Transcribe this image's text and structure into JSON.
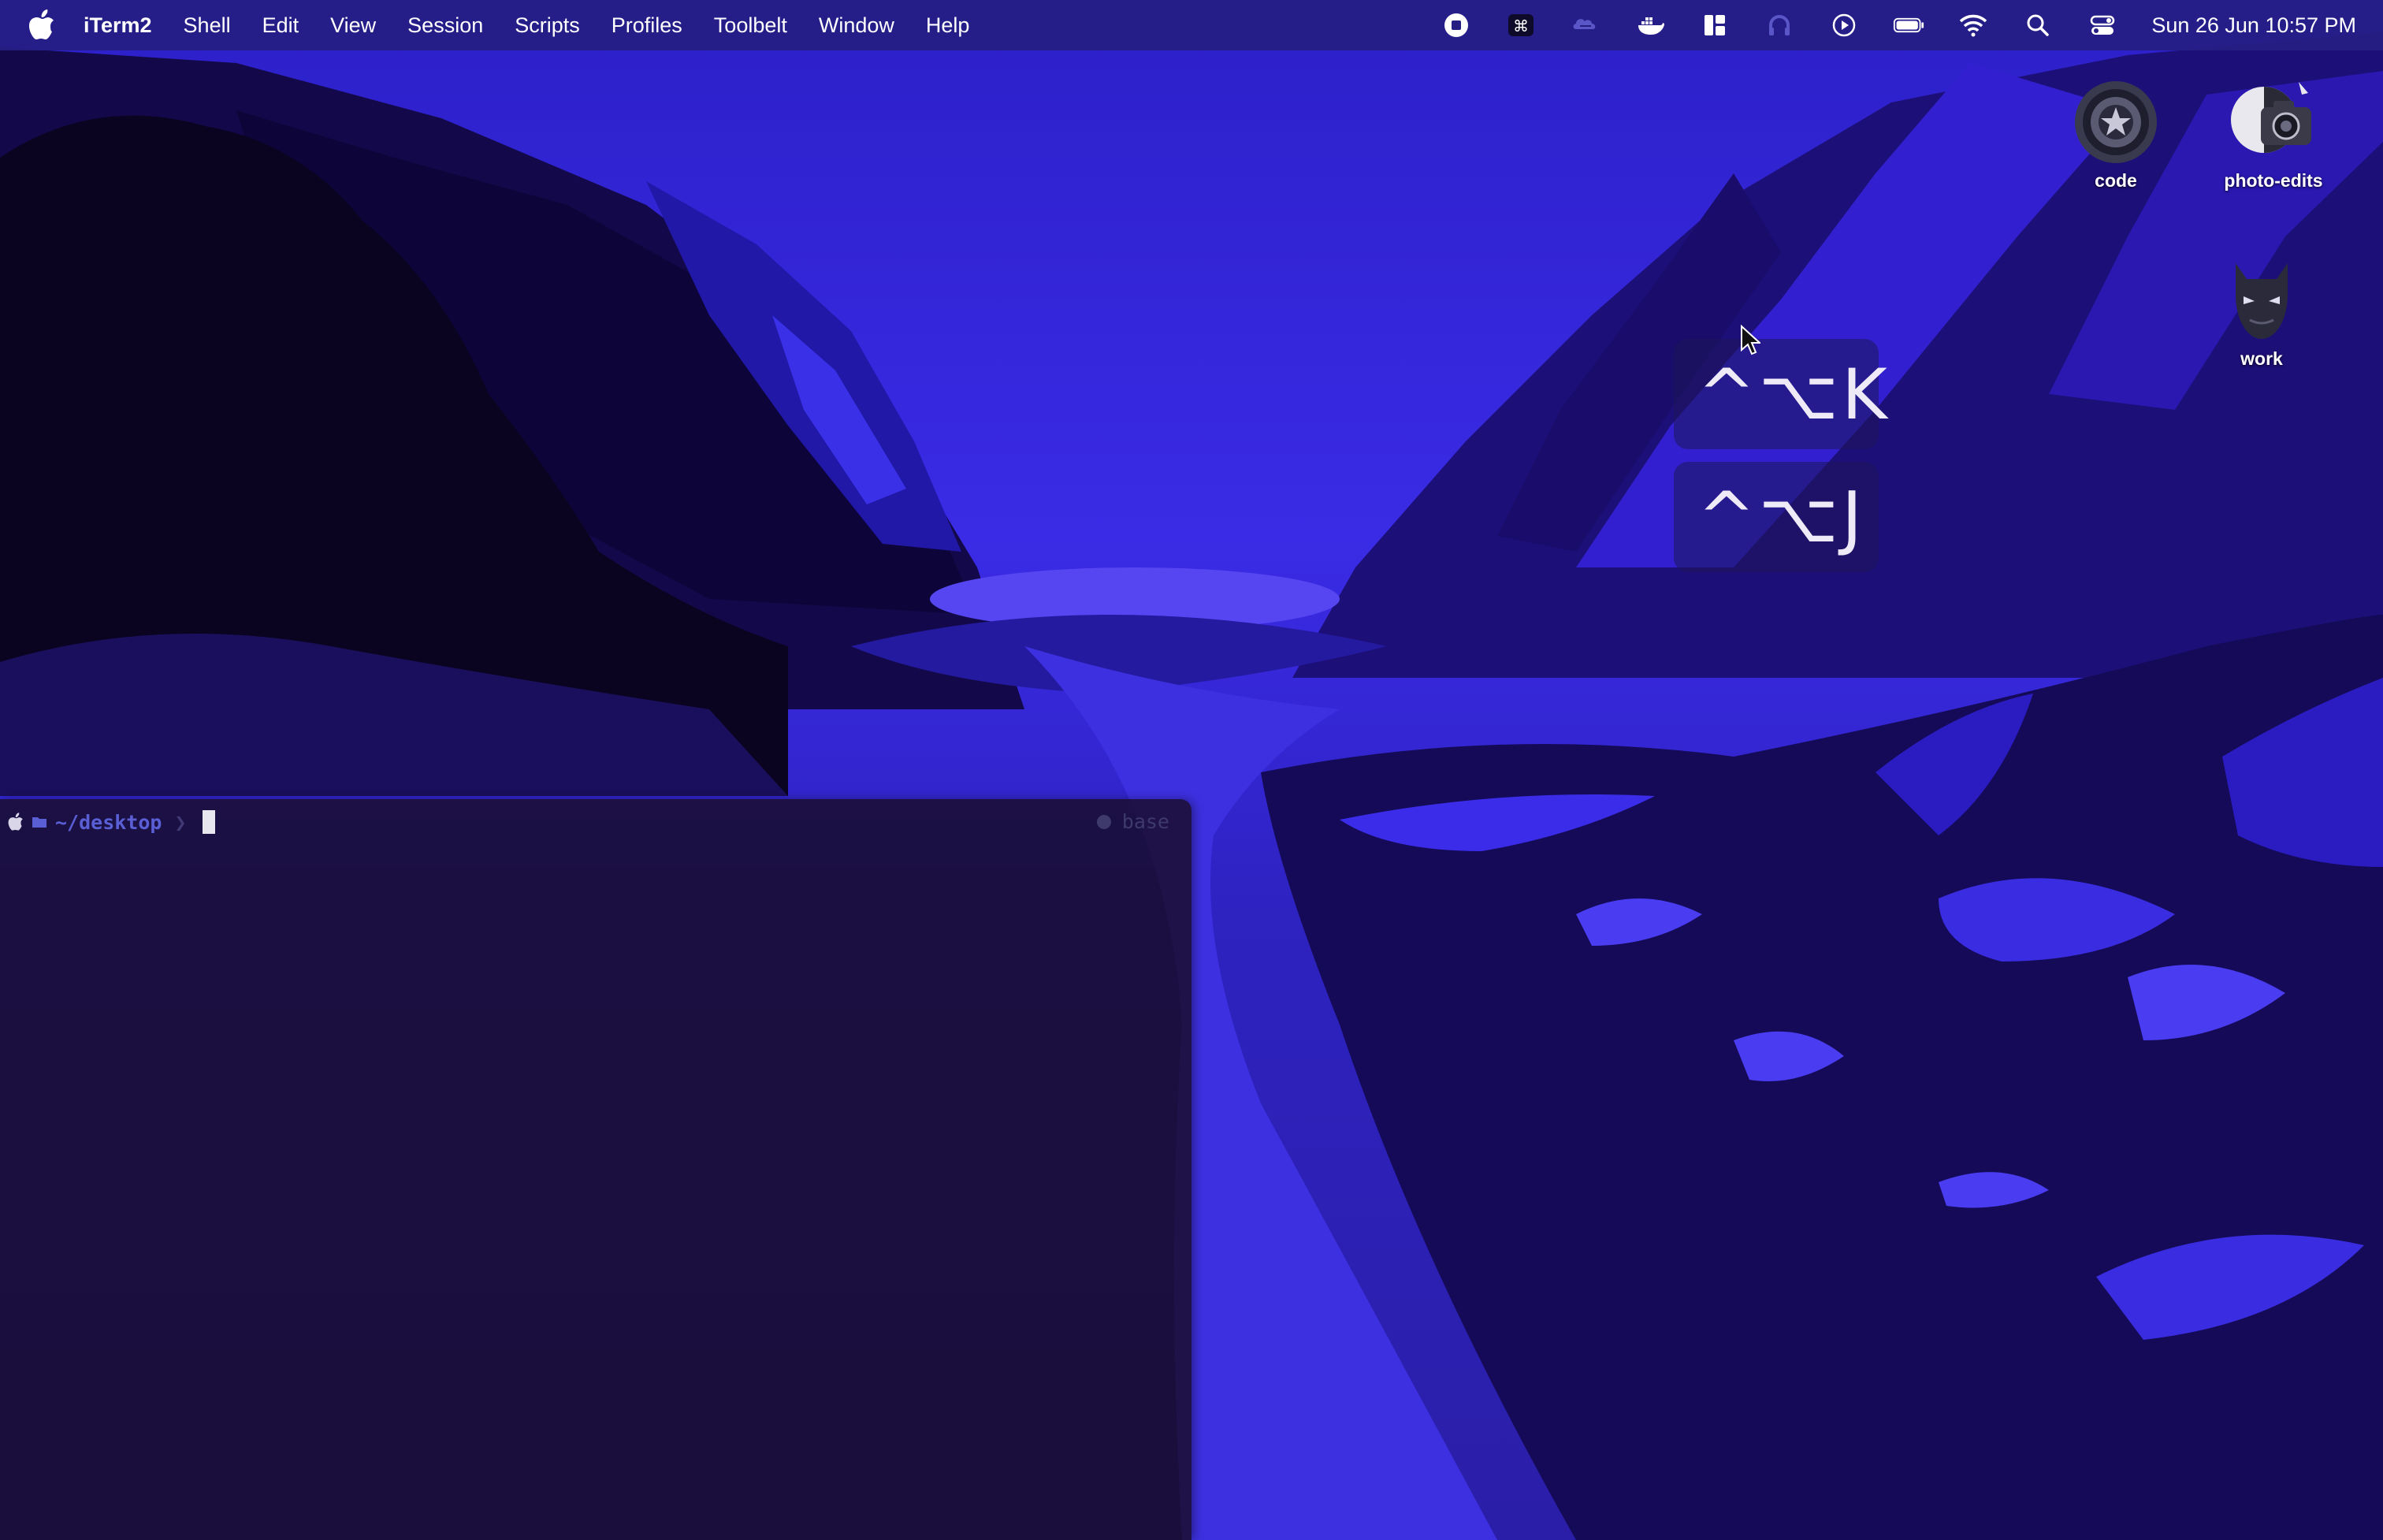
{
  "menubar": {
    "apple_icon": "apple-logo-icon",
    "app_name": "iTerm2",
    "items": [
      "Shell",
      "Edit",
      "View",
      "Session",
      "Scripts",
      "Profiles",
      "Toolbelt",
      "Window",
      "Help"
    ],
    "status_icons": [
      "screen-record-icon",
      "command-key-icon",
      "cloud-sync-icon",
      "docker-icon",
      "window-layout-icon",
      "headphones-icon",
      "play-icon",
      "battery-icon",
      "wifi-icon",
      "spotlight-search-icon",
      "control-center-icon"
    ],
    "clock": "Sun 26 Jun  10:57 PM"
  },
  "desktop": {
    "icons": [
      {
        "label": "code",
        "icon": "captain-shield-icon"
      },
      {
        "label": "photo-edits",
        "icon": "camera-icon"
      },
      {
        "label": "work",
        "icon": "batman-icon"
      }
    ]
  },
  "hints": {
    "first": "^⌥K",
    "second": "^⌥J"
  },
  "terminal": {
    "path": "~/desktop",
    "chevron": "❯",
    "env_label": "base"
  },
  "colors": {
    "menubar": "#261e82",
    "sky": "#3a2be0",
    "terminal_bg": "#160a1e",
    "prompt_path": "#5a5fd6"
  }
}
